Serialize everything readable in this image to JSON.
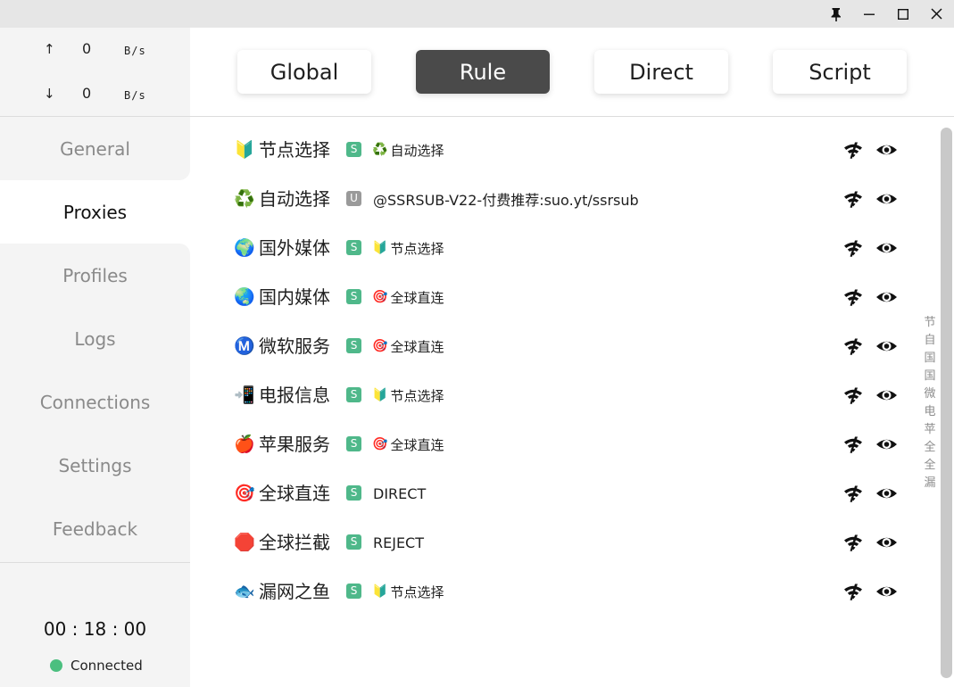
{
  "window": {
    "pin_glyph": "🖈",
    "minimize_glyph": "—",
    "maximize_glyph": "☐",
    "close_glyph": "✕"
  },
  "traffic": {
    "up_arrow": "↑",
    "up_value": "0",
    "up_unit": "B/s",
    "down_arrow": "↓",
    "down_value": "0",
    "down_unit": "B/s"
  },
  "nav": {
    "items": [
      {
        "label": "General"
      },
      {
        "label": "Proxies"
      },
      {
        "label": "Profiles"
      },
      {
        "label": "Logs"
      },
      {
        "label": "Connections"
      },
      {
        "label": "Settings"
      },
      {
        "label": "Feedback"
      }
    ],
    "active": "Proxies"
  },
  "footer": {
    "timer": "00 : 18 : 00",
    "status": "Connected",
    "status_color": "#4bbf7f"
  },
  "modes": {
    "items": [
      {
        "label": "Global"
      },
      {
        "label": "Rule"
      },
      {
        "label": "Direct"
      },
      {
        "label": "Script"
      }
    ],
    "active": "Rule"
  },
  "proxies": [
    {
      "icon": "🔰",
      "name": "节点选择",
      "type": "S",
      "sel_icon": "♻️",
      "sel": "自动选择"
    },
    {
      "icon": "♻️",
      "name": "自动选择",
      "type": "U",
      "sel_icon": "",
      "sel": "@SSRSUB-V22-付费推荐:suo.yt/ssrsub"
    },
    {
      "icon": "🌍",
      "name": "国外媒体",
      "type": "S",
      "sel_icon": "🔰",
      "sel": "节点选择"
    },
    {
      "icon": "🌏",
      "name": "国内媒体",
      "type": "S",
      "sel_icon": "🎯",
      "sel": "全球直连"
    },
    {
      "icon": "Ⓜ️",
      "name": "微软服务",
      "type": "S",
      "sel_icon": "🎯",
      "sel": "全球直连"
    },
    {
      "icon": "📲",
      "name": "电报信息",
      "type": "S",
      "sel_icon": "🔰",
      "sel": "节点选择"
    },
    {
      "icon": "🍎",
      "name": "苹果服务",
      "type": "S",
      "sel_icon": "🎯",
      "sel": "全球直连"
    },
    {
      "icon": "🎯",
      "name": "全球直连",
      "type": "S",
      "sel_icon": "",
      "sel": "DIRECT"
    },
    {
      "icon": "🛑",
      "name": "全球拦截",
      "type": "S",
      "sel_icon": "",
      "sel": "REJECT"
    },
    {
      "icon": "🐟",
      "name": "漏网之鱼",
      "type": "S",
      "sel_icon": "🔰",
      "sel": "节点选择"
    }
  ],
  "index_letters": [
    "节",
    "自",
    "国",
    "国",
    "微",
    "电",
    "苹",
    "全",
    "全",
    "漏"
  ]
}
